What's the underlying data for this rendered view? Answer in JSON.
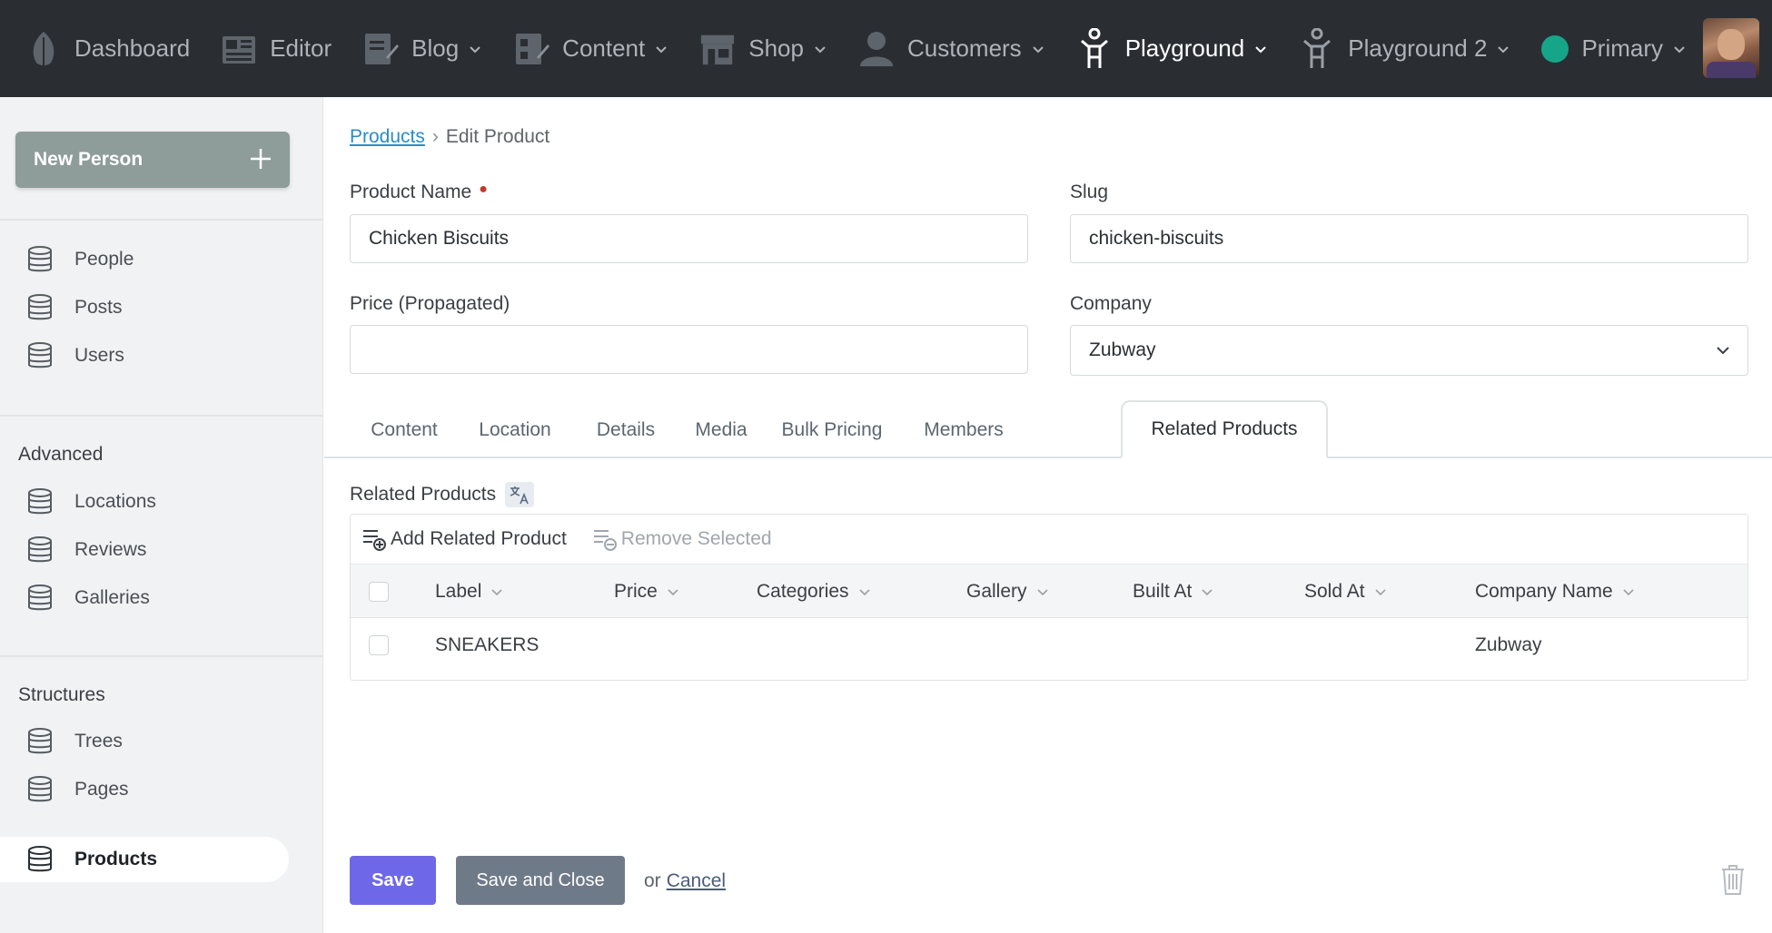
{
  "nav": {
    "items": [
      {
        "label": "Dashboard",
        "icon": "leaf-icon",
        "chevron": false
      },
      {
        "label": "Editor",
        "icon": "newspaper-icon",
        "chevron": false
      },
      {
        "label": "Blog",
        "icon": "blog-edit-icon",
        "chevron": true
      },
      {
        "label": "Content",
        "icon": "content-icon",
        "chevron": true
      },
      {
        "label": "Shop",
        "icon": "shop-icon",
        "chevron": true
      },
      {
        "label": "Customers",
        "icon": "person-icon",
        "chevron": true
      },
      {
        "label": "Playground",
        "icon": "stick-figure-icon",
        "chevron": true
      },
      {
        "label": "Playground 2",
        "icon": "stick-figure-icon",
        "chevron": true
      },
      {
        "label": "Primary",
        "icon": "green-dot-icon",
        "chevron": true
      }
    ],
    "active_index": 6,
    "avatar": "user-avatar"
  },
  "sidebar": {
    "new_button": "New Person",
    "items": [
      {
        "label": "People"
      },
      {
        "label": "Posts"
      },
      {
        "label": "Users"
      },
      {
        "label": "Locations"
      },
      {
        "label": "Reviews"
      },
      {
        "label": "Galleries"
      },
      {
        "label": "Trees"
      },
      {
        "label": "Pages"
      },
      {
        "label": "Products"
      }
    ],
    "sections": {
      "advanced": "Advanced",
      "structures": "Structures"
    },
    "active_item": "Products"
  },
  "breadcrumb": {
    "parent": "Products",
    "separator": "›",
    "current": "Edit Product"
  },
  "form": {
    "product_name": {
      "label": "Product Name",
      "value": "Chicken Biscuits",
      "required": true
    },
    "slug": {
      "label": "Slug",
      "value": "chicken-biscuits"
    },
    "price": {
      "label": "Price (Propagated)",
      "value": ""
    },
    "company": {
      "label": "Company",
      "value": "Zubway"
    }
  },
  "tabs": [
    {
      "label": "Content"
    },
    {
      "label": "Location"
    },
    {
      "label": "Details"
    },
    {
      "label": "Media"
    },
    {
      "label": "Bulk Pricing"
    },
    {
      "label": "Members"
    },
    {
      "label": "Related Products"
    }
  ],
  "active_tab": "Related Products",
  "related": {
    "label": "Related Products",
    "add_button": "Add Related Product",
    "remove_button": "Remove Selected",
    "columns": [
      "Label",
      "Price",
      "Categories",
      "Gallery",
      "Built At",
      "Sold At",
      "Company Name"
    ],
    "rows": [
      {
        "label": "SNEAKERS",
        "price": "",
        "categories": "",
        "gallery": "",
        "built_at": "",
        "sold_at": "",
        "company_name": "Zubway"
      }
    ]
  },
  "actions": {
    "save": "Save",
    "save_close": "Save and Close",
    "or": "or",
    "cancel": "Cancel"
  },
  "colors": {
    "nav_bg": "#2a2e33",
    "save": "#6e68e8",
    "save_close": "#6f7a89",
    "link": "#2b8bc9",
    "accent_dot": "#17a589"
  }
}
